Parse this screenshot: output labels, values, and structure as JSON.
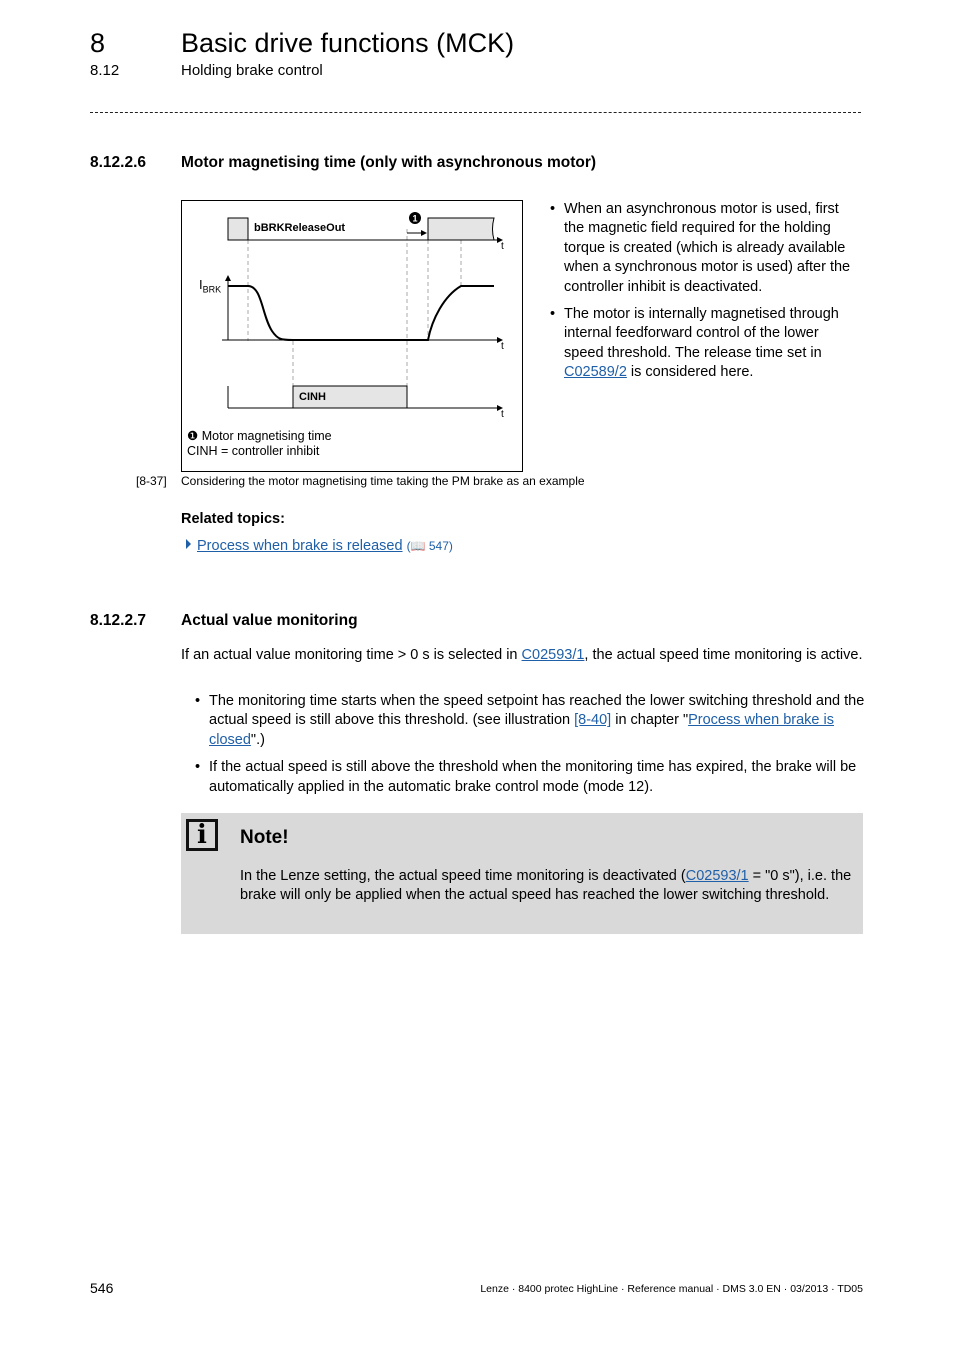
{
  "header": {
    "chapter_number": "8",
    "chapter_title": "Basic drive functions (MCK)",
    "section_number": "8.12",
    "section_title": "Holding brake control"
  },
  "section_8_12_2_6": {
    "number": "8.12.2.6",
    "title": "Motor magnetising time (only with asynchronous motor)",
    "figure": {
      "signal_top_label": "bBRKReleaseOut",
      "current_label": "I",
      "current_subscript": "BRK",
      "cinh_label": "CINH",
      "axis_label": "t",
      "marker_symbol": "❶",
      "legend_line1": "Motor magnetising time",
      "legend_line2": "CINH = controller inhibit"
    },
    "bullets": [
      {
        "text": "When an asynchronous motor is used, first the magnetic field required for the holding torque is created (which is already available when a synchronous motor is used) after the controller inhibit is deactivated."
      },
      {
        "text_before": "The motor is internally magnetised through internal feedforward control of the lower speed threshold. The release time set in ",
        "link": "C02589/2",
        "text_after": " is considered here."
      }
    ],
    "caption_number": "[8-37]",
    "caption_text": "Considering the motor magnetising time taking the PM brake as an example",
    "related_topics_title": "Related topics:",
    "related_link": "Process when brake is released",
    "related_page_prefix": "(",
    "related_page_icon": "book-icon",
    "related_page": "547)"
  },
  "section_8_12_2_7": {
    "number": "8.12.2.7",
    "title": "Actual value monitoring",
    "intro_before": "If an actual value monitoring time > 0 s is selected in ",
    "intro_link": "C02593/1",
    "intro_after": ", the actual speed time monitoring is active.",
    "bullets": [
      {
        "text_before": "The monitoring time starts when the speed setpoint has reached the lower switching threshold and the actual speed is still above this threshold. (see illustration ",
        "link1": "[8-40]",
        "text_mid": " in chapter \"",
        "link2": "Process when brake is closed",
        "text_after": "\".)"
      },
      {
        "text": "If the actual speed is still above the threshold when the monitoring time has expired, the brake will be automatically applied in the automatic brake control mode (mode 12)."
      }
    ],
    "note": {
      "icon": "info-icon",
      "title": "Note!",
      "text_before": "In the Lenze setting, the actual speed time monitoring is deactivated (",
      "link": "C02593/1",
      "text_after": " = \"0 s\"), i.e. the brake will only be applied when the actual speed has reached the lower switching threshold."
    }
  },
  "footer": {
    "page_number": "546",
    "info": "Lenze · 8400 protec HighLine · Reference manual · DMS 3.0 EN · 03/2013 · TD05"
  }
}
